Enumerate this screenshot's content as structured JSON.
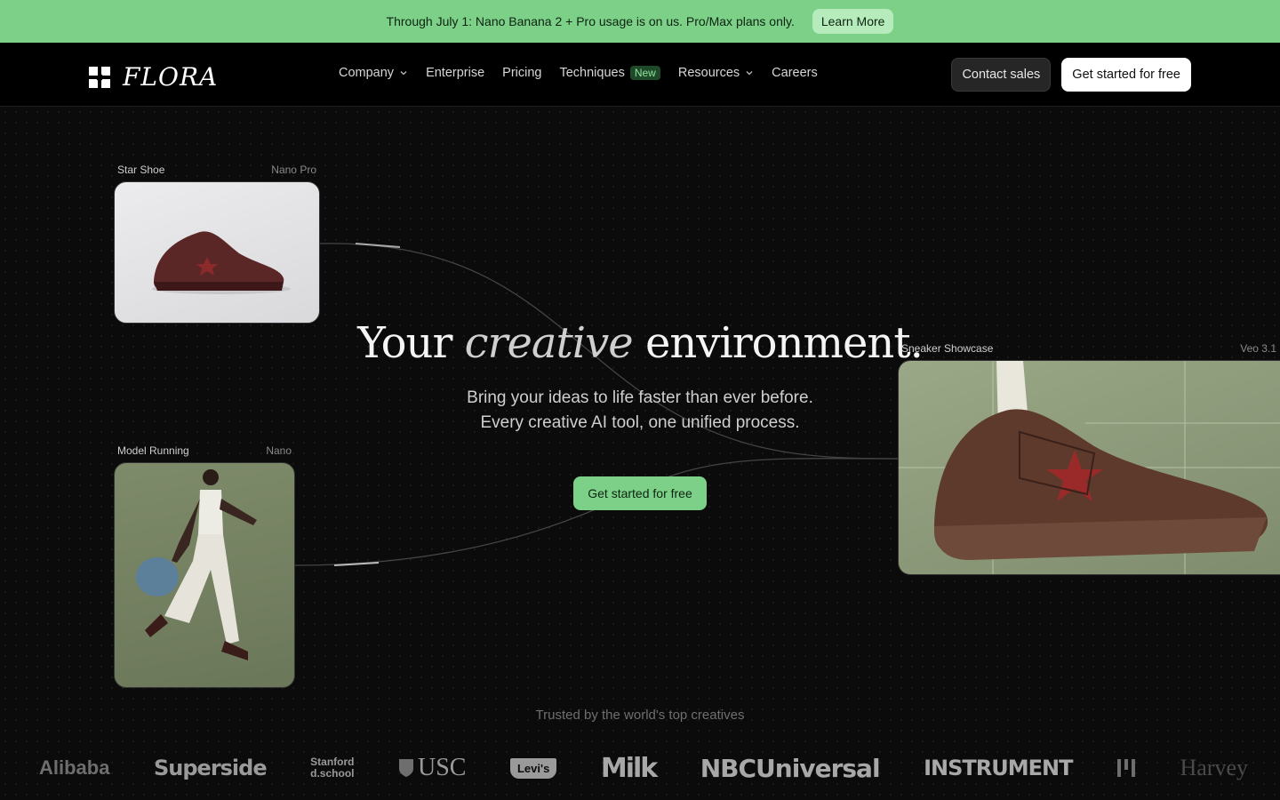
{
  "announcement": {
    "text": "Through July 1: Nano Banana 2 + Pro usage is on us. Pro/Max plans only.",
    "button": "Learn More"
  },
  "nav": {
    "logo_word": "FLORA",
    "links": [
      "Company",
      "Enterprise",
      "Pricing",
      "Techniques",
      "Resources",
      "Careers"
    ],
    "badge": "New",
    "contact": "Contact sales",
    "start": "Get started for free"
  },
  "hero": {
    "headline_pre": "Your",
    "headline_ital": "creative",
    "headline_post": "environment.",
    "sub_1": "Bring your ideas to life faster than ever before.",
    "sub_2": "Every creative AI tool, one unified process.",
    "cta": "Get started for free"
  },
  "cards": {
    "star": {
      "title": "Star Shoe",
      "model": "Nano Pro"
    },
    "runner": {
      "title": "Model Running",
      "model": "Nano"
    },
    "sneaker": {
      "title": "Sneaker Showcase",
      "model": "Veo 3.1"
    }
  },
  "trusted": {
    "heading": "Trusted by the world's top creatives",
    "logos": [
      "Alibaba",
      "Superside",
      "Stanford",
      "d.school",
      "USC",
      "Levi's",
      "Milk",
      "NBCUniversal",
      "INSTRUMENT",
      "Harvey"
    ]
  },
  "colors": {
    "accent": "#7dd087",
    "background": "#0a0a0a"
  }
}
